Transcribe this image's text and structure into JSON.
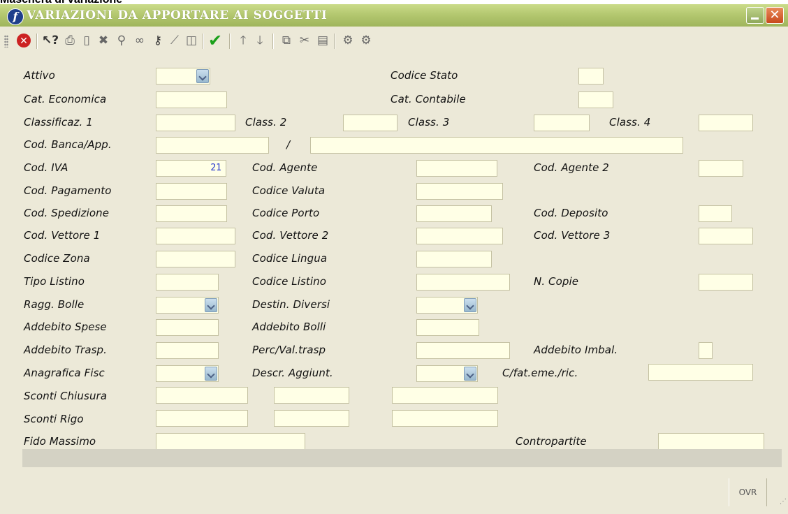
{
  "caption": "Maschera di variazione",
  "window": {
    "title": "VARIAZIONI DA APPORTARE AI SOGGETTI",
    "app_icon": "f"
  },
  "toolbar": {
    "icons": [
      "stop-icon",
      "help-pointer-icon",
      "print-icon",
      "new-document-icon",
      "delete-icon",
      "magnifier-icon",
      "binoculars-icon",
      "key-icon",
      "wand-icon",
      "columns-icon",
      "checkmark-icon",
      "arrow-up-icon",
      "arrow-down-icon",
      "copy-icon",
      "cut-icon",
      "paste-icon",
      "gear-icon",
      "gears-icon"
    ]
  },
  "labels": {
    "attivo": "Attivo",
    "codice_stato": "Codice Stato",
    "cat_economica": "Cat. Economica",
    "cat_contabile": "Cat. Contabile",
    "classificaz1": "Classificaz. 1",
    "class2": "Class. 2",
    "class3": "Class. 3",
    "class4": "Class. 4",
    "cod_banca": "Cod. Banca/App.",
    "slash": "/",
    "cod_iva": "Cod. IVA",
    "cod_agente": "Cod. Agente",
    "cod_agente2": "Cod. Agente 2",
    "cod_pagamento": "Cod. Pagamento",
    "codice_valuta": "Codice Valuta",
    "cod_spedizione": "Cod. Spedizione",
    "codice_porto": "Codice Porto",
    "cod_deposito": "Cod. Deposito",
    "cod_vettore1": "Cod. Vettore 1",
    "cod_vettore2": "Cod. Vettore 2",
    "cod_vettore3": "Cod. Vettore 3",
    "codice_zona": "Codice Zona",
    "codice_lingua": "Codice Lingua",
    "tipo_listino": "Tipo Listino",
    "codice_listino": "Codice Listino",
    "n_copie": "N. Copie",
    "ragg_bolle": "Ragg. Bolle",
    "destin_diversi": "Destin. Diversi",
    "addebito_spese": "Addebito Spese",
    "addebito_bolli": "Addebito Bolli",
    "addebito_trasp": "Addebito Trasp.",
    "perc_val_trasp": "Perc/Val.trasp",
    "addebito_imbal": "Addebito Imbal.",
    "anagrafica_fisc": "Anagrafica Fisc",
    "descr_aggiunt": "Descr. Aggiunt.",
    "cfat": "C/fat.eme./ric.",
    "sconti_chiusura": "Sconti Chiusura",
    "sconti_rigo": "Sconti Rigo",
    "fido_massimo": "Fido Massimo",
    "contropartite": "Contropartite"
  },
  "values": {
    "cod_iva": "21"
  },
  "status": {
    "ovr": "OVR"
  }
}
